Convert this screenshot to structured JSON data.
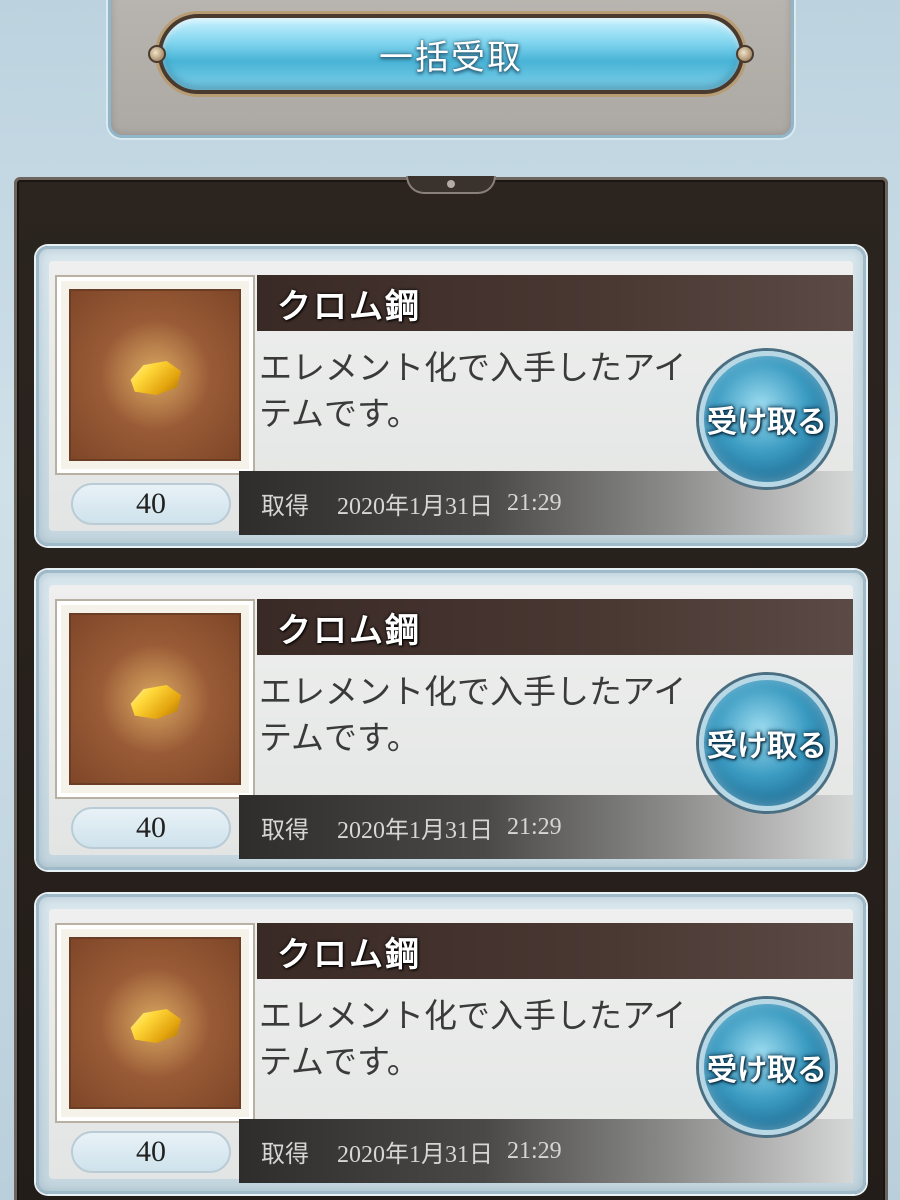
{
  "header": {
    "bulk_receive_label": "一括受取"
  },
  "items": [
    {
      "name": "クロム鋼",
      "description": "エレメント化で入手したアイテムです。",
      "count": "40",
      "date_label": "取得",
      "date": "2020年1月31日",
      "time": "21:29",
      "receive_label": "受け取る",
      "icon": "gold-ore-icon"
    },
    {
      "name": "クロム鋼",
      "description": "エレメント化で入手したアイテムです。",
      "count": "40",
      "date_label": "取得",
      "date": "2020年1月31日",
      "time": "21:29",
      "receive_label": "受け取る",
      "icon": "gold-ore-icon"
    },
    {
      "name": "クロム鋼",
      "description": "エレメント化で入手したアイテムです。",
      "count": "40",
      "date_label": "取得",
      "date": "2020年1月31日",
      "time": "21:29",
      "receive_label": "受け取る",
      "icon": "gold-ore-icon"
    }
  ],
  "colors": {
    "button_blue": "#49b3d6",
    "frame_dark": "#2b241f",
    "name_bar": "#3a2a25"
  }
}
